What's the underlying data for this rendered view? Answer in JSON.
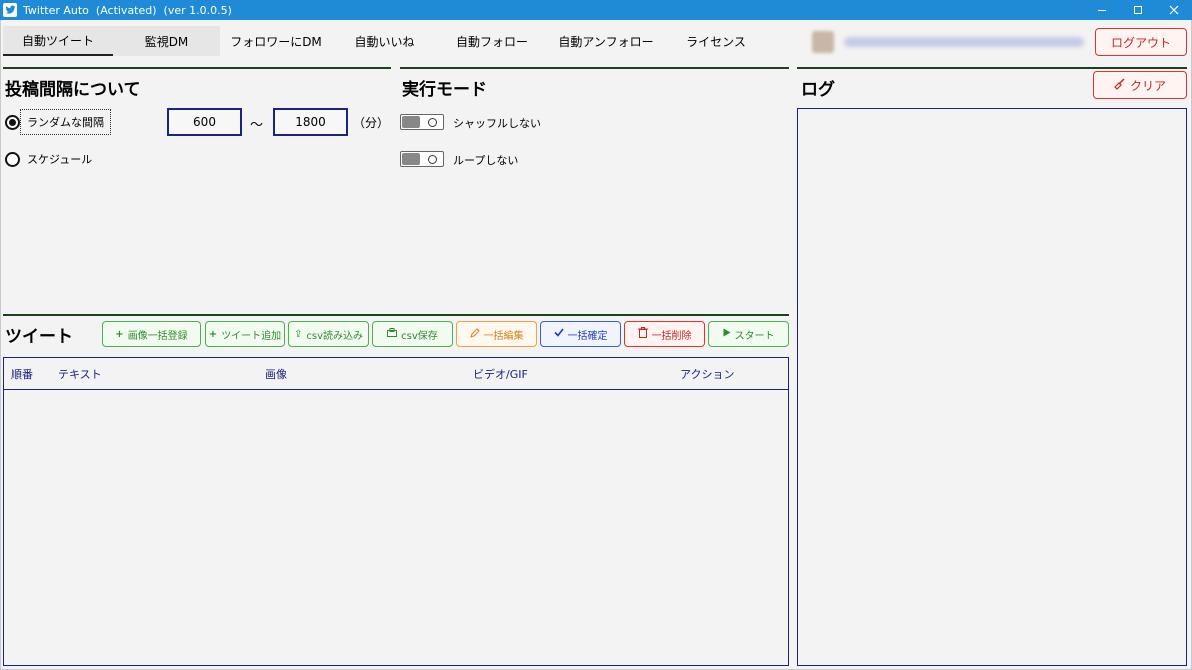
{
  "window": {
    "title": "Twitter Auto  (Activated)  (ver 1.0.0.5)",
    "minimize_icon": "minimize-icon",
    "maximize_icon": "maximize-icon",
    "close_icon": "close-icon"
  },
  "tabs": [
    {
      "label": "自動ツイート",
      "active": true
    },
    {
      "label": "監視DM"
    },
    {
      "label": "フォロワーにDM"
    },
    {
      "label": "自動いいね"
    },
    {
      "label": "自動フォロー"
    },
    {
      "label": "自動アンフォロー"
    },
    {
      "label": "ライセンス"
    }
  ],
  "header": {
    "logout_label": "ログアウト"
  },
  "interval": {
    "title": "投稿間隔について",
    "random_label": "ランダムな間隔",
    "schedule_label": "スケジュール",
    "min_value": "600",
    "separator": "〜",
    "max_value": "1800",
    "unit": "（分）",
    "selected": "random"
  },
  "mode": {
    "title": "実行モード",
    "shuffle_label": "シャッフルしない",
    "loop_label": "ループしない"
  },
  "log": {
    "title": "ログ",
    "clear_label": "クリア"
  },
  "tweet": {
    "title": "ツイート",
    "buttons": {
      "bulk_image": "画像一括登録",
      "add_tweet": "ツイート追加",
      "csv_import": "csv読み込み",
      "csv_save": "csv保存",
      "bulk_edit": "一括編集",
      "bulk_confirm": "一括確定",
      "bulk_delete": "一括削除",
      "start": "スタート"
    },
    "columns": [
      "順番",
      "テキスト",
      "画像",
      "ビデオ/GIF",
      "アクション"
    ],
    "rows": []
  },
  "colors": {
    "titlebar": "#1f8bd6",
    "accent_navy": "#1a237e",
    "red": "#c0282a",
    "green": "#2e8b2e",
    "orange": "#d9801c",
    "blue": "#1f3fb8"
  }
}
